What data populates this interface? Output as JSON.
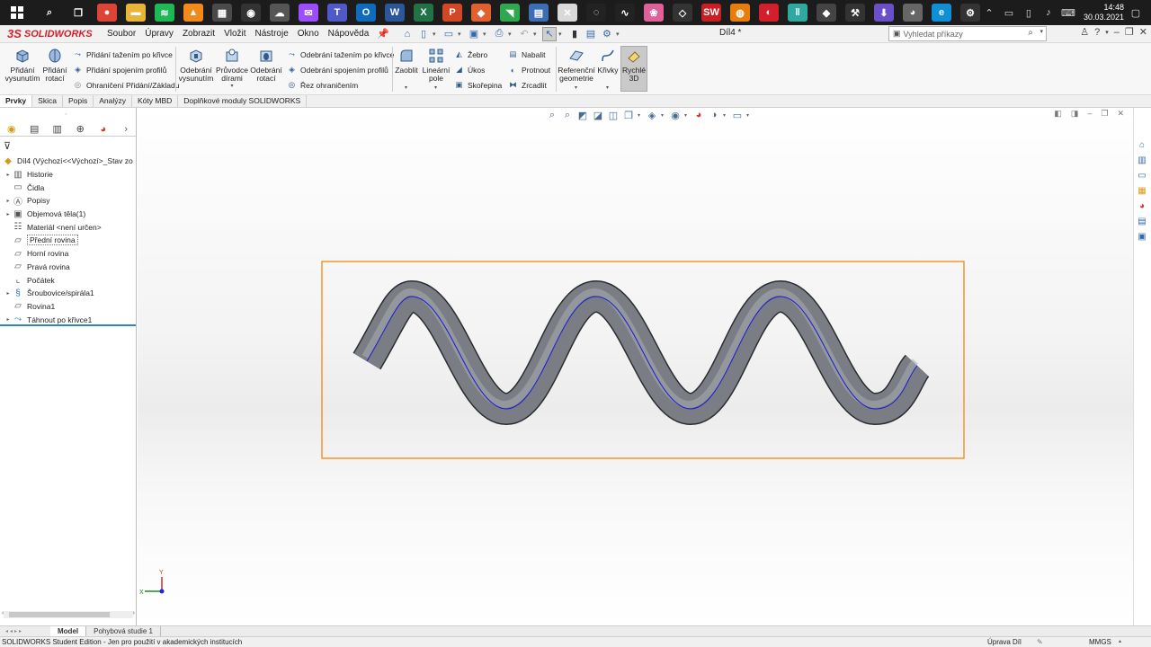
{
  "taskbar": {
    "clock_time": "14:48",
    "clock_date": "30.03.2021",
    "apps": [
      {
        "name": "search-app-icon",
        "glyph": "⌕",
        "color": "#1c1c1c"
      },
      {
        "name": "task-view-icon",
        "glyph": "❐",
        "color": "#1c1c1c"
      },
      {
        "name": "chrome-icon",
        "glyph": "●",
        "color": "#db4437"
      },
      {
        "name": "file-explorer-icon",
        "glyph": "▬",
        "color": "#e8b53a"
      },
      {
        "name": "spotify-icon",
        "glyph": "≋",
        "color": "#1db954"
      },
      {
        "name": "vlc-icon",
        "glyph": "▲",
        "color": "#f28a1b"
      },
      {
        "name": "calculator-icon",
        "glyph": "▦",
        "color": "#4a4a4a"
      },
      {
        "name": "obs-icon",
        "glyph": "◉",
        "color": "#333"
      },
      {
        "name": "cloud-app-icon",
        "glyph": "☁",
        "color": "#555"
      },
      {
        "name": "messenger-icon",
        "glyph": "✉",
        "color": "#9b4dff"
      },
      {
        "name": "teams-icon",
        "glyph": "T",
        "color": "#5059c9"
      },
      {
        "name": "outlook-icon",
        "glyph": "O",
        "color": "#0f6cbd"
      },
      {
        "name": "word-icon",
        "glyph": "W",
        "color": "#2b579a"
      },
      {
        "name": "excel-icon",
        "glyph": "X",
        "color": "#217346"
      },
      {
        "name": "powerpoint-icon",
        "glyph": "P",
        "color": "#d24726"
      },
      {
        "name": "ink-app-icon",
        "glyph": "◆",
        "color": "#e06030"
      },
      {
        "name": "green-app-icon",
        "glyph": "◥",
        "color": "#2fa84f"
      },
      {
        "name": "notepad-icon",
        "glyph": "▤",
        "color": "#3d6db5"
      },
      {
        "name": "pdf-app-icon",
        "glyph": "✕",
        "color": "#d9d9d9"
      },
      {
        "name": "shell-icon",
        "glyph": "◌",
        "color": "#222"
      },
      {
        "name": "graph-app-icon",
        "glyph": "∿",
        "color": "#222"
      },
      {
        "name": "pink-app-icon",
        "glyph": "❀",
        "color": "#e0609a"
      },
      {
        "name": "inkscape-icon",
        "glyph": "◇",
        "color": "#333"
      },
      {
        "name": "solidworks-app-icon",
        "glyph": "SW",
        "color": "#c81e24"
      },
      {
        "name": "blender-icon",
        "glyph": "◍",
        "color": "#e87d0d"
      },
      {
        "name": "red-app-icon",
        "glyph": "◐",
        "color": "#d31f2b"
      },
      {
        "name": "bars-app-icon",
        "glyph": "‖",
        "color": "#2fa8a0"
      },
      {
        "name": "diamond-app-icon",
        "glyph": "◆",
        "color": "#444"
      },
      {
        "name": "tools-app-icon",
        "glyph": "⚒",
        "color": "#333"
      },
      {
        "name": "download-app-icon",
        "glyph": "⬇",
        "color": "#6a4fc8"
      },
      {
        "name": "gray-app-icon",
        "glyph": "◕",
        "color": "#666"
      },
      {
        "name": "edge-icon",
        "glyph": "e",
        "color": "#0f8fd6"
      },
      {
        "name": "gear-app-icon",
        "glyph": "⚙",
        "color": "#333"
      }
    ]
  },
  "menubar": {
    "logo_mark": "3S",
    "logo_text": "SOLIDWORKS",
    "menus": [
      "Soubor",
      "Úpravy",
      "Zobrazit",
      "Vložit",
      "Nástroje",
      "Okno",
      "Nápověda"
    ],
    "document_title": "Díl4 *",
    "search_placeholder": "Vyhledat příkazy"
  },
  "ribbon": {
    "big_buttons": [
      {
        "id": "extrude-boss",
        "label": "Přidání vysunutím"
      },
      {
        "id": "revolve-boss",
        "label": "Přidání rotací"
      },
      {
        "id": "extruded-cut",
        "label": "Odebrání vysunutím"
      },
      {
        "id": "hole-wizard",
        "label": "Průvodce dírami"
      },
      {
        "id": "revolved-cut",
        "label": "Odebrání rotací"
      },
      {
        "id": "fillet",
        "label": "Zaoblit"
      },
      {
        "id": "linear-pattern",
        "label": "Lineární pole"
      },
      {
        "id": "reference-geometry",
        "label": "Referenční geometrie"
      },
      {
        "id": "curves",
        "label": "Křivky"
      },
      {
        "id": "instant3d",
        "label": "Rychlé 3D"
      }
    ],
    "small_buttons": [
      {
        "id": "swept-boss",
        "label": "Přidání tažením po křivce"
      },
      {
        "id": "lofted-boss",
        "label": "Přidání spojením profilů"
      },
      {
        "id": "boundary-boss",
        "label": "Ohraničení Přidání/Základu"
      },
      {
        "id": "swept-cut",
        "label": "Odebrání tažením po křivce"
      },
      {
        "id": "lofted-cut",
        "label": "Odebrání spojením profilů"
      },
      {
        "id": "boundary-cut",
        "label": "Řez ohraničením"
      },
      {
        "id": "rib",
        "label": "Žebro"
      },
      {
        "id": "draft",
        "label": "Úkos"
      },
      {
        "id": "shell",
        "label": "Skořepina"
      },
      {
        "id": "wrap",
        "label": "Nabalit"
      },
      {
        "id": "intersect",
        "label": "Protnout"
      },
      {
        "id": "mirror",
        "label": "Zrcadlit"
      }
    ]
  },
  "tabs": [
    "Prvky",
    "Skica",
    "Popis",
    "Analýzy",
    "Kóty MBD",
    "Doplňkové moduly SOLIDWORKS"
  ],
  "feature_tree": {
    "root": "Díl4  (Výchozí<<Výchozí>_Stav zo",
    "items": [
      {
        "label": "Historie",
        "expandable": true,
        "icon": "history-icon"
      },
      {
        "label": "Čidla",
        "expandable": false,
        "icon": "sensor-icon"
      },
      {
        "label": "Popisy",
        "expandable": true,
        "icon": "annotations-icon"
      },
      {
        "label": "Objemová tělа(1)",
        "expandable": true,
        "icon": "solid-bodies-icon"
      },
      {
        "label": "Materiál <není určen>",
        "expandable": false,
        "icon": "material-icon"
      },
      {
        "label": "Přední rovina",
        "expandable": false,
        "icon": "plane-icon"
      },
      {
        "label": "Horní rovina",
        "expandable": false,
        "icon": "plane-icon"
      },
      {
        "label": "Pravá rovina",
        "expandable": false,
        "icon": "plane-icon"
      },
      {
        "label": "Počátek",
        "expandable": false,
        "icon": "origin-icon"
      },
      {
        "label": "Šroubovice/spirála1",
        "expandable": true,
        "icon": "helix-icon"
      },
      {
        "label": "Rovina1",
        "expandable": false,
        "icon": "plane-icon"
      },
      {
        "label": "Táhnout po křivce1",
        "expandable": true,
        "icon": "sweep-icon"
      }
    ]
  },
  "triad_labels": {
    "x": "X",
    "y": "Y"
  },
  "sheet_tabs": [
    "Model",
    "Pohybová studie 1"
  ],
  "statusbar": {
    "left_text": "SOLIDWORKS Student Edition - Jen pro použití v akademických institucích",
    "edit_mode": "Úprava Díl",
    "units": "MMGS"
  },
  "colors": {
    "solidworks_red": "#d21f2a",
    "selection_box": "#f0921e",
    "sweep_body": "#6f7379",
    "path_curve": "#1a1ad8",
    "rollback_bar": "#2e86c1"
  }
}
